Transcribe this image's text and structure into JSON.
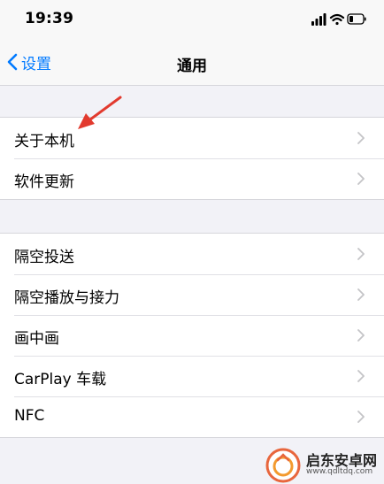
{
  "status": {
    "time": "19:39",
    "icons": [
      "signal-icon",
      "wifi-icon",
      "battery-icon"
    ]
  },
  "nav": {
    "back_label": "设置",
    "title": "通用"
  },
  "groups": [
    {
      "rows": [
        {
          "label": "关于本机"
        },
        {
          "label": "软件更新"
        }
      ]
    },
    {
      "rows": [
        {
          "label": "隔空投送"
        },
        {
          "label": "隔空播放与接力"
        },
        {
          "label": "画中画"
        },
        {
          "label": "CarPlay 车载"
        },
        {
          "label": "NFC"
        }
      ]
    }
  ],
  "watermark": {
    "title": "启东安卓网",
    "url": "www.qdltdq.com"
  },
  "colors": {
    "accent": "#007aff",
    "arrow": "#e23a2e",
    "background": "#f2f2f7",
    "chevron": "#c4c4c7"
  }
}
